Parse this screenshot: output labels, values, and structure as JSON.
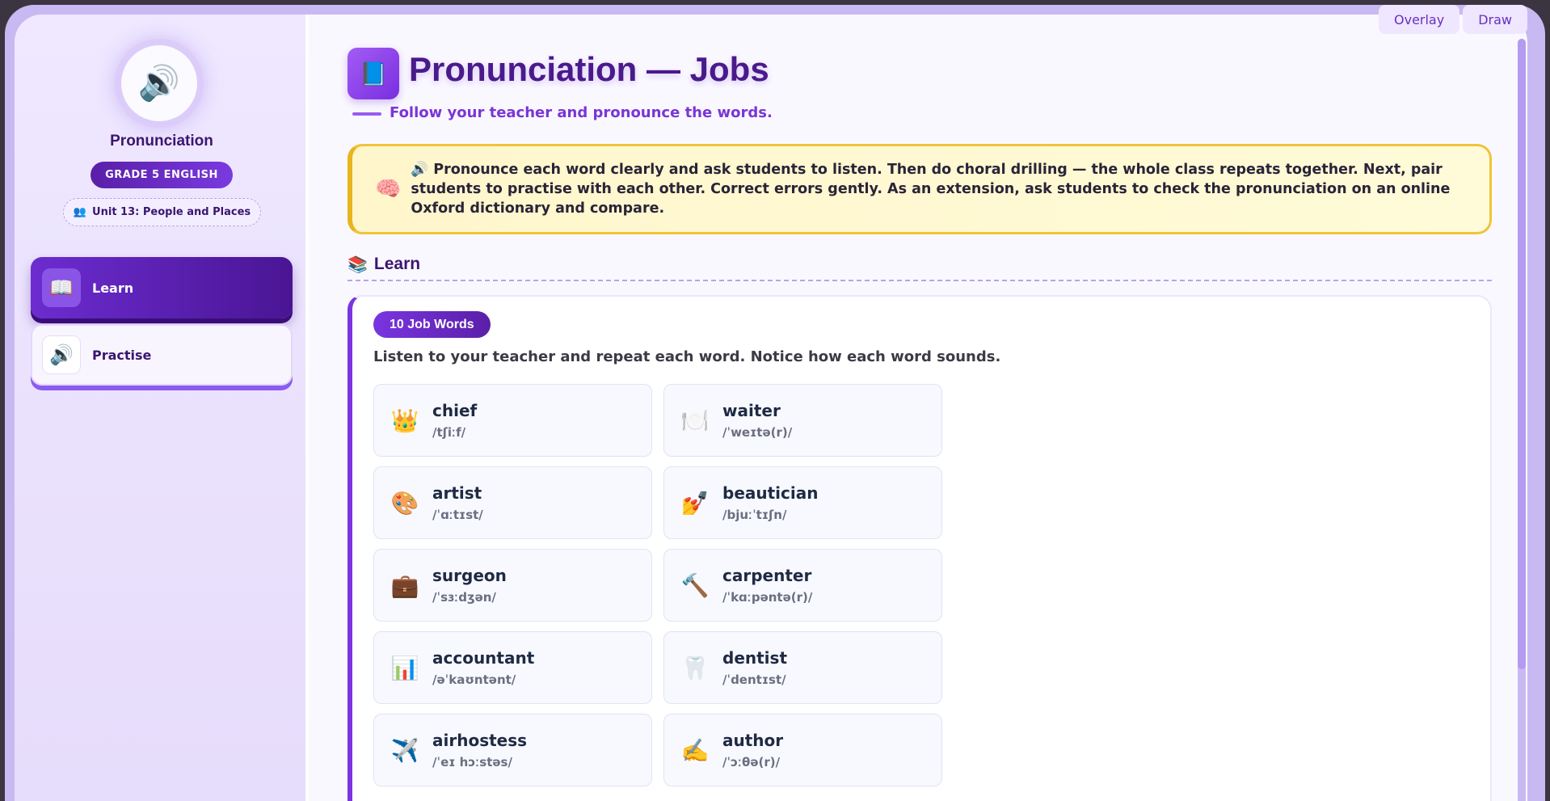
{
  "sidebar": {
    "title": "Pronunciation",
    "avatar_icon": "🔊",
    "grade_badge": "GRADE 5 ENGLISH",
    "unit_icon": "👥",
    "unit": "Unit 13: People and Places",
    "nav": [
      {
        "label": "Learn",
        "icon": "📖",
        "active": true
      },
      {
        "label": "Practise",
        "icon": "🔊",
        "active": false
      }
    ]
  },
  "header": {
    "icon": "📘",
    "title": "Pronunciation — Jobs",
    "subtitle": "Follow your teacher and pronounce the words."
  },
  "note": {
    "icon": "🧠",
    "text": "🔊 Pronounce each word clearly and ask students to listen. Then do choral drilling — the whole class repeats together. Next, pair students to practise with each other. Correct errors gently. As an extension, ask students to check the pronunciation on an online Oxford dictionary and compare."
  },
  "section": {
    "icon": "📚",
    "title": "Learn"
  },
  "card": {
    "badge": "10 Job Words",
    "instruction": "Listen to your teacher and repeat each word. Notice how each word sounds.",
    "words": [
      {
        "icon": "👑",
        "word": "chief",
        "ipa": "/tʃiːf/"
      },
      {
        "icon": "🍽️",
        "word": "waiter",
        "ipa": "/ˈweɪtə(r)/"
      },
      {
        "icon": "🎨",
        "word": "artist",
        "ipa": "/ˈɑːtɪst/"
      },
      {
        "icon": "💅",
        "word": "beautician",
        "ipa": "/bjuːˈtɪʃn/"
      },
      {
        "icon": "💼",
        "word": "surgeon",
        "ipa": "/ˈsɜːdʒən/"
      },
      {
        "icon": "🔨",
        "word": "carpenter",
        "ipa": "/ˈkɑːpəntə(r)/"
      },
      {
        "icon": "📊",
        "word": "accountant",
        "ipa": "/əˈkaʊntənt/"
      },
      {
        "icon": "🦷",
        "word": "dentist",
        "ipa": "/ˈdentɪst/"
      },
      {
        "icon": "✈️",
        "word": "airhostess",
        "ipa": "/ˈeɪ hɔːstəs/"
      },
      {
        "icon": "✍️",
        "word": "author",
        "ipa": "/ˈɔːθə(r)/"
      }
    ]
  },
  "toolbar": {
    "overlay": "Overlay",
    "draw": "Draw"
  },
  "colors": {
    "accent": "#7a35e0",
    "note_bg": "#fff6cc",
    "note_border": "#f0c43a"
  }
}
